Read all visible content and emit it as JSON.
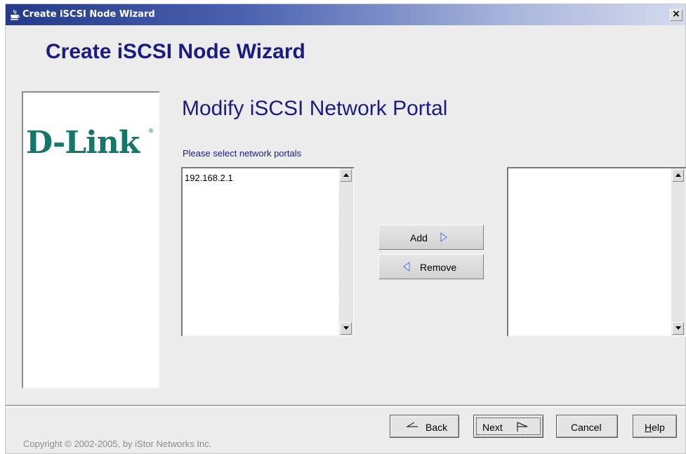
{
  "window": {
    "title": "Create iSCSI Node Wizard",
    "close_label": "×"
  },
  "wizard": {
    "heading": "Create iSCSI Node Wizard",
    "logo_text": "D-Link",
    "logo_reg": "®",
    "step_title": "Modify iSCSI Network Portal",
    "list_label": "Please select network portals",
    "available_portals": [
      "192.168.2.1"
    ],
    "selected_portals": []
  },
  "buttons": {
    "add": "Add",
    "remove": "Remove",
    "back": "Back",
    "next": "Next",
    "cancel": "Cancel",
    "help_first": "H",
    "help_rest": "elp"
  },
  "footer": {
    "copyright": "Copyright © 2002-2005, by iStor Networks Inc."
  },
  "colors": {
    "heading": "#1c1c80",
    "logo": "#15766a",
    "arrow": "#6f7fd8",
    "title_bar_start": "#243a88"
  },
  "icons": {
    "app": "java-cup-icon",
    "close": "close-icon",
    "scroll_up": "triangle-up-icon",
    "scroll_down": "triangle-down-icon",
    "add_arrow": "triangle-right-icon",
    "remove_arrow": "triangle-left-icon",
    "back_arrow": "back-flag-icon",
    "next_arrow": "next-flag-icon"
  }
}
